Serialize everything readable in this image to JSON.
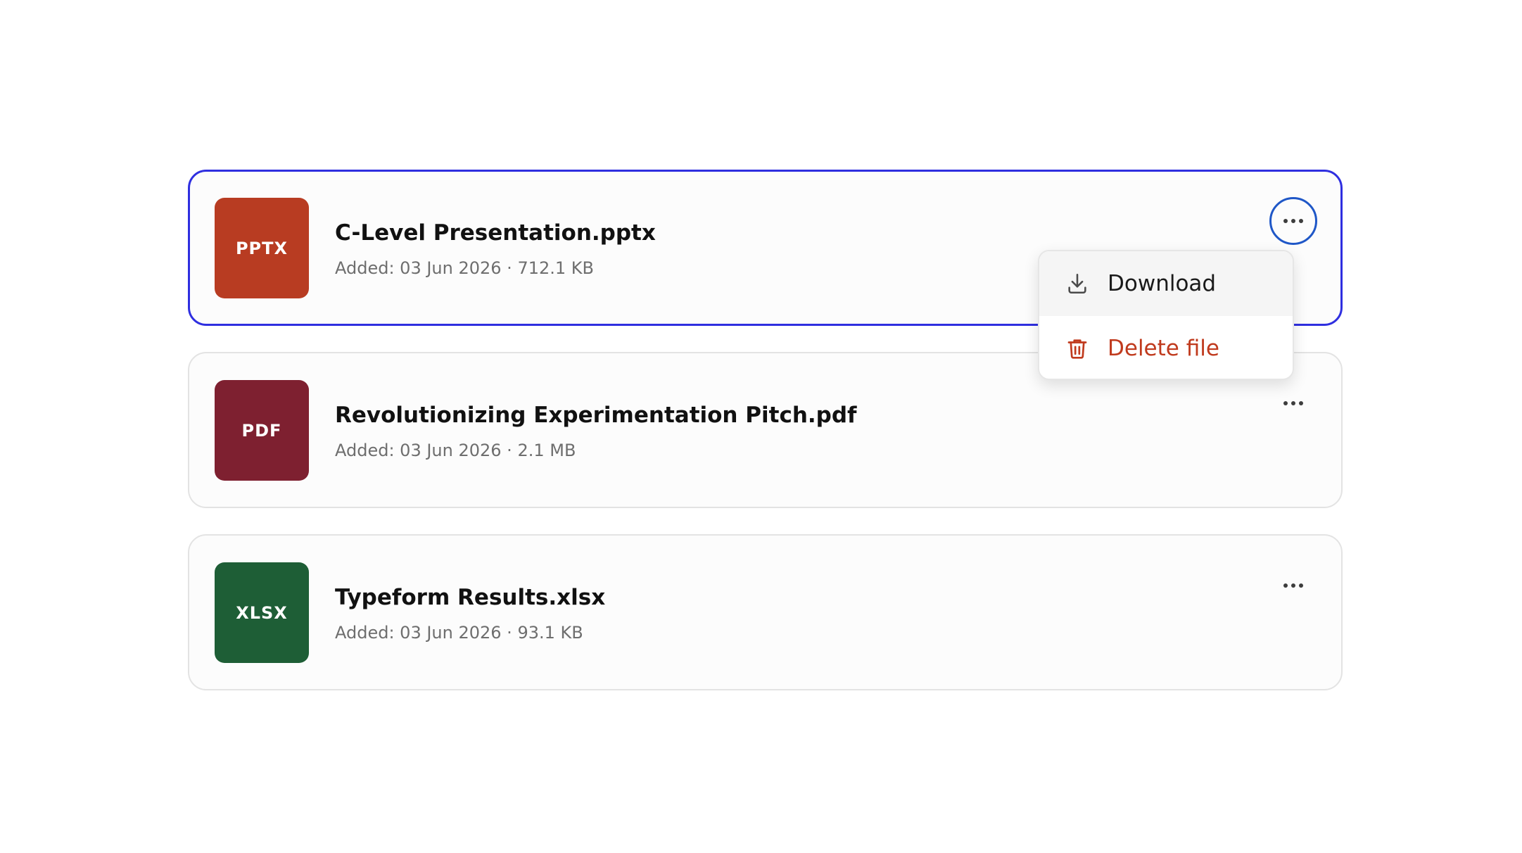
{
  "files": [
    {
      "badge": "PPTX",
      "badge_color": "#b83c22",
      "name": "C-Level Presentation.pptx",
      "meta": "Added: 03 Jun 2026 · 712.1 KB",
      "selected": true
    },
    {
      "badge": "PDF",
      "badge_color": "#7e2030",
      "name": "Revolutionizing Experimentation Pitch.pdf",
      "meta": "Added: 03 Jun 2026 · 2.1 MB",
      "selected": false
    },
    {
      "badge": "XLSX",
      "badge_color": "#1e5e36",
      "name": "Typeform Results.xlsx",
      "meta": "Added: 03 Jun 2026 · 93.1 KB",
      "selected": false
    }
  ],
  "menu": {
    "download_label": "Download",
    "download_icon": "download-icon",
    "delete_label": "Delete file",
    "delete_icon": "trash-icon",
    "delete_color": "#c03a1d"
  },
  "colors": {
    "selected_border": "#2f2fe0",
    "focus_ring": "#1f57c7"
  }
}
